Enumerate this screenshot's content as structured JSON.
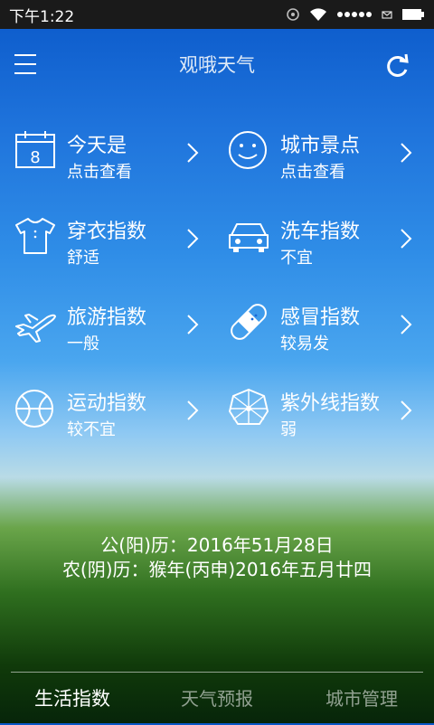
{
  "status": {
    "time": "下午1:22"
  },
  "header": {
    "title": "观哦天气"
  },
  "cells": [
    {
      "label": "今天是",
      "value": "点击查看",
      "icon": "calendar-icon"
    },
    {
      "label": "城市景点",
      "value": "点击查看",
      "icon": "smiley-icon"
    },
    {
      "label": "穿衣指数",
      "value": "舒适",
      "icon": "shirt-icon"
    },
    {
      "label": "洗车指数",
      "value": "不宜",
      "icon": "car-icon"
    },
    {
      "label": "旅游指数",
      "value": "一般",
      "icon": "airplane-icon"
    },
    {
      "label": "感冒指数",
      "value": "较易发",
      "icon": "bandage-icon"
    },
    {
      "label": "运动指数",
      "value": "较不宜",
      "icon": "ball-icon"
    },
    {
      "label": "紫外线指数",
      "value": "弱",
      "icon": "umbrella-icon"
    }
  ],
  "dates": {
    "solar": "公(阳)历：2016年51月28日",
    "lunar": "农(阴)历：猴年(丙申)2016年五月廿四"
  },
  "tabs": [
    {
      "label": "生活指数",
      "active": true
    },
    {
      "label": "天气预报",
      "active": false
    },
    {
      "label": "城市管理",
      "active": false
    }
  ]
}
